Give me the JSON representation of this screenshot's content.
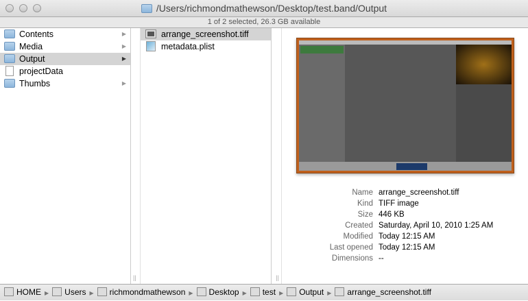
{
  "window": {
    "title": "/Users/richmondmathewson/Desktop/test.band/Output",
    "status": "1 of 2 selected, 26.3 GB available"
  },
  "column1": [
    {
      "label": "Contents",
      "icon": "folder-icon",
      "arrow": true,
      "selected": false
    },
    {
      "label": "Media",
      "icon": "folder-icon",
      "arrow": true,
      "selected": false
    },
    {
      "label": "Output",
      "icon": "folder-icon",
      "arrow": true,
      "selected": true
    },
    {
      "label": "projectData",
      "icon": "document-icon",
      "arrow": false,
      "selected": false
    },
    {
      "label": "Thumbs",
      "icon": "folder-icon",
      "arrow": true,
      "selected": false
    }
  ],
  "column2": [
    {
      "label": "arrange_screenshot.tiff",
      "icon": "tiff-icon",
      "selected": true
    },
    {
      "label": "metadata.plist",
      "icon": "plist-icon",
      "selected": false
    }
  ],
  "info": [
    {
      "label": "Name",
      "value": "arrange_screenshot.tiff"
    },
    {
      "label": "Kind",
      "value": "TIFF image"
    },
    {
      "label": "Size",
      "value": "446 KB"
    },
    {
      "label": "Created",
      "value": "Saturday, April 10, 2010 1:25 AM"
    },
    {
      "label": "Modified",
      "value": "Today 12:15 AM"
    },
    {
      "label": "Last opened",
      "value": "Today 12:15 AM"
    },
    {
      "label": "Dimensions",
      "value": "--"
    }
  ],
  "path": [
    "HOME",
    "Users",
    "richmondmathewson",
    "Desktop",
    "test",
    "Output",
    "arrange_screenshot.tiff"
  ]
}
